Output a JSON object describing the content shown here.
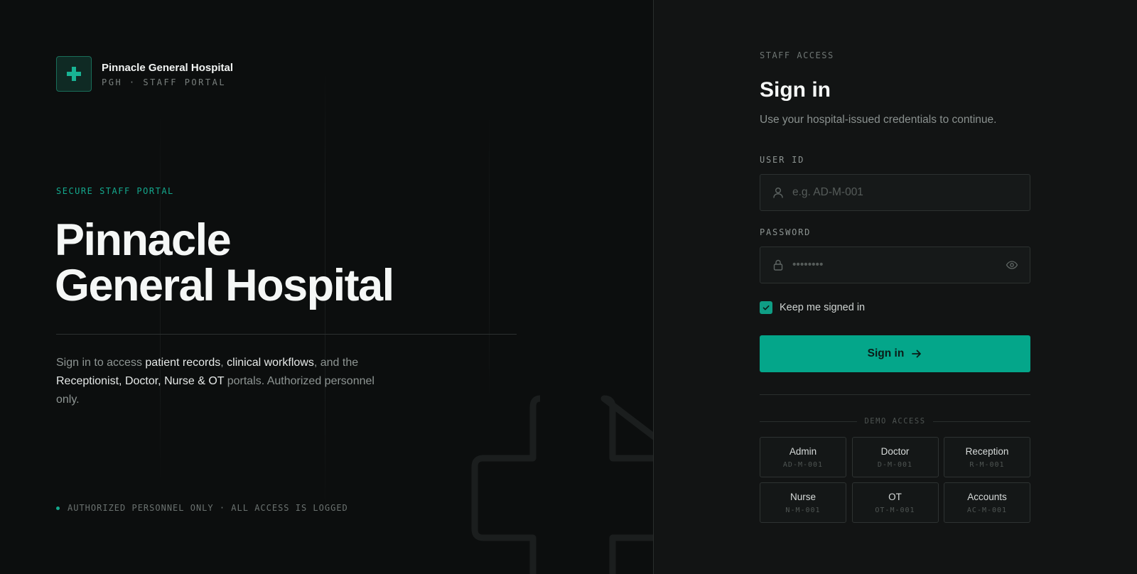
{
  "brand": {
    "name": "Pinnacle General Hospital",
    "subtitle": "PGH · STAFF PORTAL",
    "logo_icon": "medical-cross-icon",
    "accent": "#04a68a"
  },
  "hero": {
    "eyebrow": "SECURE STAFF PORTAL",
    "title_line1": "Pinnacle",
    "title_line2": "General Hospital",
    "desc": {
      "p1": "Sign in to access ",
      "hl1": "patient records",
      "p2": ", ",
      "hl2": "clinical workflows",
      "p3": ", and the ",
      "hl3": "Receptionist, Doctor, Nurse & OT",
      "p4": " portals. Authorized personnel only."
    },
    "footer_note": "AUTHORIZED PERSONNEL ONLY · ALL ACCESS IS LOGGED"
  },
  "signin": {
    "eyebrow": "STAFF ACCESS",
    "title": "Sign in",
    "subtitle": "Use your hospital-issued credentials to continue.",
    "user_id": {
      "label": "USER ID",
      "placeholder": "e.g. AD-M-001",
      "value": "",
      "icon": "user-icon"
    },
    "password": {
      "label": "PASSWORD",
      "placeholder": "••••••••",
      "value": "",
      "icon": "lock-icon",
      "toggle_icon": "eye-icon"
    },
    "keep_signed_in": {
      "label": "Keep me signed in",
      "checked": true
    },
    "submit_label": "Sign in",
    "submit_icon": "arrow-right-icon"
  },
  "demo": {
    "heading": "DEMO ACCESS",
    "accounts": [
      {
        "role": "Admin",
        "id": "AD-M-001"
      },
      {
        "role": "Doctor",
        "id": "D-M-001"
      },
      {
        "role": "Reception",
        "id": "R-M-001"
      },
      {
        "role": "Nurse",
        "id": "N-M-001"
      },
      {
        "role": "OT",
        "id": "OT-M-001"
      },
      {
        "role": "Accounts",
        "id": "AC-M-001"
      }
    ]
  }
}
